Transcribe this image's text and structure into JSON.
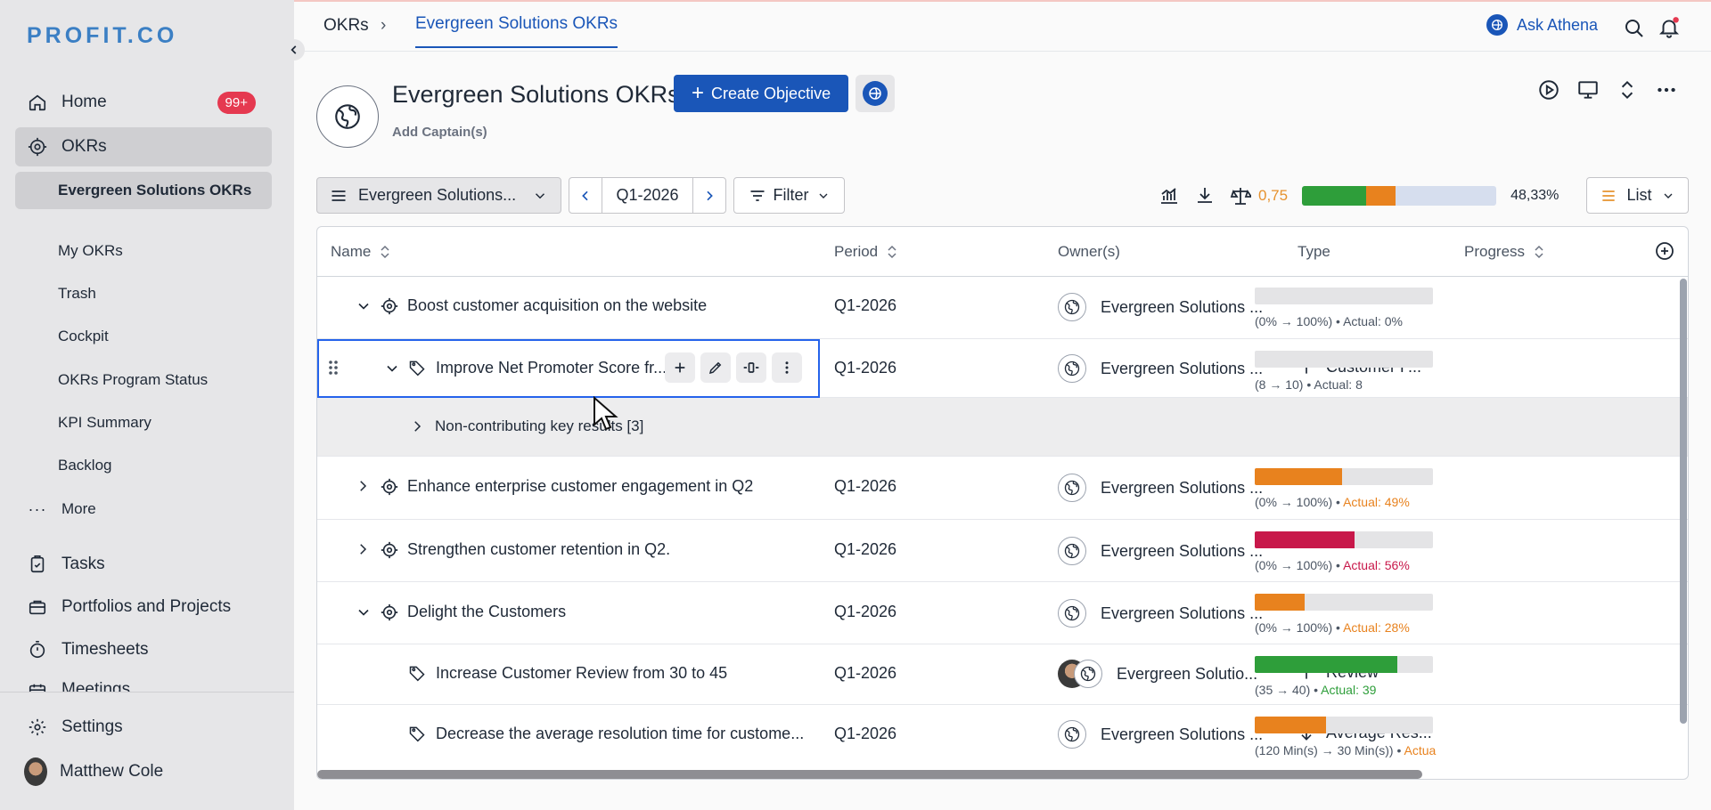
{
  "brand": {
    "logo": "PROFIT.CO"
  },
  "sidebar": {
    "home": {
      "label": "Home",
      "badge": "99+"
    },
    "okrs": {
      "label": "OKRs"
    },
    "sub_items": [
      "Evergreen Solutions OKRs",
      "My OKRs",
      "Trash",
      "Cockpit",
      "OKRs Program Status",
      "KPI Summary",
      "Backlog"
    ],
    "more": "More",
    "tasks": "Tasks",
    "portfolios": "Portfolios and Projects",
    "timesheets": "Timesheets",
    "meetings": "Meetings",
    "settings": "Settings",
    "user": "Matthew Cole"
  },
  "topbar": {
    "breadcrumb_root": "OKRs",
    "breadcrumb_sep": "›",
    "breadcrumb_current": "Evergreen Solutions OKRs",
    "ask_athena": "Ask Athena"
  },
  "header": {
    "title": "Evergreen Solutions OKRs",
    "create_button": "Create Objective",
    "add_captain": "Add Captain(s)"
  },
  "toolbar": {
    "group_select": "Evergreen Solutions...",
    "period": "Q1-2026",
    "filter": "Filter",
    "score": "0,75",
    "overall_green": 0.33,
    "overall_orange": 0.15,
    "overall_pct": "48,33%",
    "view": "List"
  },
  "table": {
    "headers": {
      "name": "Name",
      "period": "Period",
      "owners": "Owner(s)",
      "type": "Type",
      "progress": "Progress"
    },
    "rows": [
      {
        "name": "Boost customer acquisition on the website",
        "period": "Q1-2026",
        "owner": "Evergreen Solutions ...",
        "type": "",
        "progress": 0,
        "color": "#e4e4e6",
        "range": "(0% → 100%) •",
        "actual": "Actual: 0%",
        "actual_color": "#4b5563"
      },
      {
        "name": "Improve Net Promoter Score fr...",
        "period": "Q1-2026",
        "owner": "Evergreen Solutions ...",
        "type": "Customer F...",
        "progress": 0,
        "color": "#e4e4e6",
        "range": "(8  →  10) •",
        "actual": "Actual: 8",
        "actual_color": "#4b5563"
      },
      {
        "name": "Non-contributing key results [3]"
      },
      {
        "name": "Enhance enterprise customer engagement in Q2",
        "period": "Q1-2026",
        "owner": "Evergreen Solutions ...",
        "type": "",
        "progress": 0.49,
        "color": "#e8821e",
        "range": "(0% → 100%) •",
        "actual": "Actual: 49%",
        "actual_color": "#e8821e"
      },
      {
        "name": "Strengthen customer retention in Q2.",
        "period": "Q1-2026",
        "owner": "Evergreen Solutions ...",
        "type": "",
        "progress": 0.56,
        "color": "#c8184a",
        "range": "(0% → 100%) •",
        "actual": "Actual: 56%",
        "actual_color": "#c8184a"
      },
      {
        "name": "Delight the Customers",
        "period": "Q1-2026",
        "owner": "Evergreen Solutions ...",
        "type": "",
        "progress": 0.28,
        "color": "#e8821e",
        "range": "(0% → 100%) •",
        "actual": "Actual: 28%",
        "actual_color": "#e8821e"
      },
      {
        "name": "Increase Customer Review from 30 to 45",
        "period": "Q1-2026",
        "owner": "Evergreen Solutio...",
        "type": "Review",
        "progress": 0.8,
        "color": "#2e9e3a",
        "range": "(35  →  40) •",
        "actual": "Actual: 39",
        "actual_color": "#2e9e3a"
      },
      {
        "name": "Decrease the average resolution time for custome...",
        "period": "Q1-2026",
        "owner": "Evergreen Solutions ...",
        "type": "Average Res...",
        "progress": 0.4,
        "color": "#e8821e",
        "range": "(120 Min(s)  →  30 Min(s)) •",
        "actual": "Actua",
        "actual_color": "#e8821e"
      }
    ]
  }
}
